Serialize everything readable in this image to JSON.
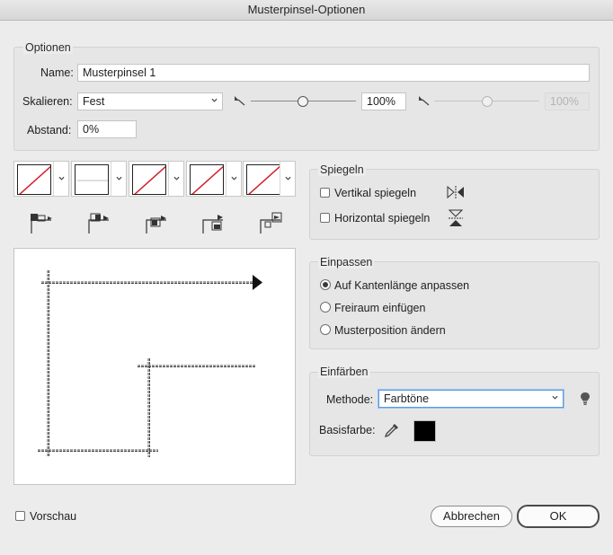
{
  "window": {
    "title": "Musterpinsel-Optionen"
  },
  "optionen": {
    "legend": "Optionen",
    "name_label": "Name:",
    "name_value": "Musterpinsel 1",
    "skalieren_label": "Skalieren:",
    "skalieren_value": "Fest",
    "scale_value": "100%",
    "scale_value_disabled": "100%",
    "scale_slider_level": 0.5,
    "abstand_label": "Abstand:",
    "abstand_value": "0%"
  },
  "tiles": [
    {
      "name": "side-tile",
      "kind": "none"
    },
    {
      "name": "outer-corner-tile",
      "kind": "line"
    },
    {
      "name": "inner-corner-tile",
      "kind": "none"
    },
    {
      "name": "start-tile",
      "kind": "none"
    },
    {
      "name": "end-tile",
      "kind": "none"
    }
  ],
  "tile_icons": [
    "side-tile-icon",
    "outer-corner-tile-icon",
    "inner-corner-tile-icon",
    "start-tile-icon",
    "end-tile-icon"
  ],
  "spiegeln": {
    "legend": "Spiegeln",
    "vertikal_label": "Vertikal spiegeln",
    "horizontal_label": "Horizontal spiegeln",
    "vertikal_checked": false,
    "horizontal_checked": false
  },
  "einpassen": {
    "legend": "Einpassen",
    "options": [
      "Auf Kantenlänge anpassen",
      "Freiraum einfügen",
      "Musterposition ändern"
    ],
    "selected": 0
  },
  "einfaerben": {
    "legend": "Einfärben",
    "methode_label": "Methode:",
    "methode_value": "Farbtöne",
    "basisfarbe_label": "Basisfarbe:",
    "basisfarbe_color": "#000000"
  },
  "footer": {
    "vorschau_label": "Vorschau",
    "vorschau_checked": false,
    "cancel_label": "Abbrechen",
    "ok_label": "OK"
  },
  "colors": {
    "swatch_none_red": "#d0202a",
    "focus_blue": "#5b9be0"
  }
}
